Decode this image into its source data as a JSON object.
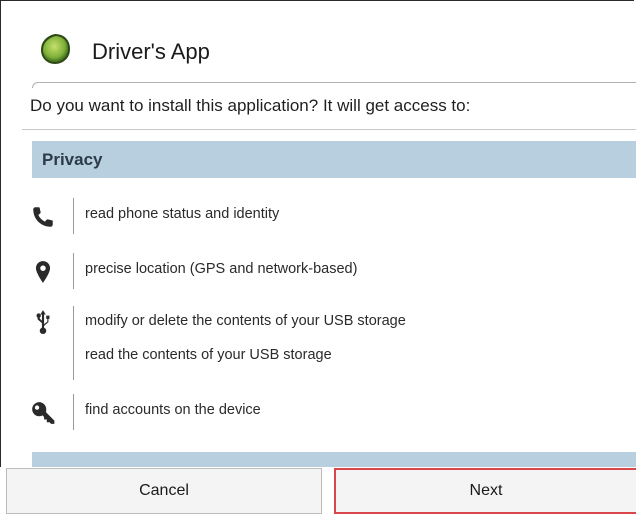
{
  "app": {
    "title": "Driver's App",
    "icon": "green-leaf-app-icon",
    "icon_color": "#7fb13a"
  },
  "prompt": "Do you want to install this application? It will get access to:",
  "sections": [
    {
      "title": "Privacy",
      "permissions": [
        {
          "icon": "phone-icon",
          "lines": [
            "read phone status and identity"
          ]
        },
        {
          "icon": "location-pin-icon",
          "lines": [
            "precise location (GPS and network-based)"
          ]
        },
        {
          "icon": "usb-icon",
          "lines": [
            "modify or delete the contents of your USB storage",
            "read the contents of your USB storage"
          ]
        },
        {
          "icon": "key-icon",
          "lines": [
            "find accounts on the device"
          ]
        }
      ]
    }
  ],
  "buttons": {
    "cancel": "Cancel",
    "next": "Next"
  },
  "colors": {
    "section_header": "#b8cfe0",
    "highlight_border": "#d9474a"
  }
}
